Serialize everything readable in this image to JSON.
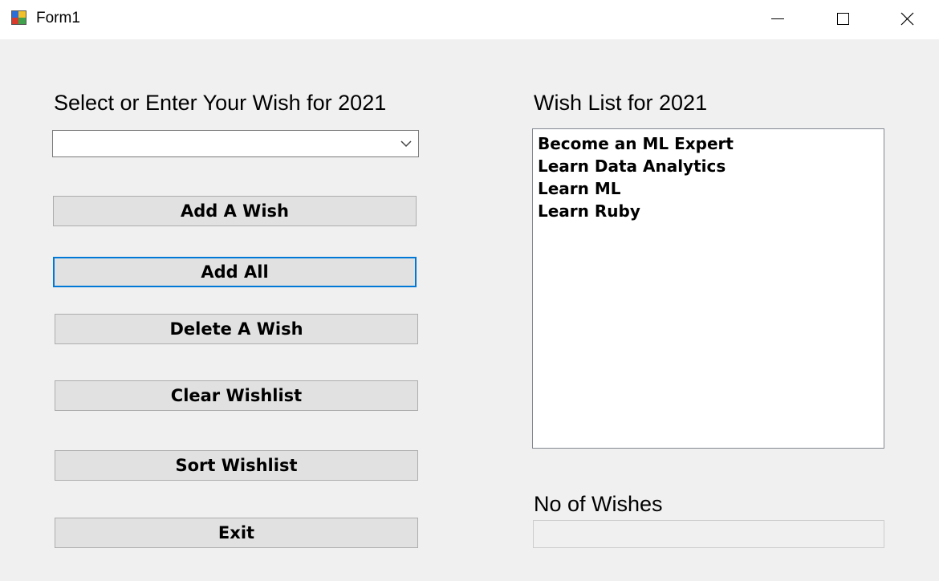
{
  "window": {
    "title": "Form1",
    "controls": [
      "minimize-icon",
      "maximize-icon",
      "close-icon"
    ]
  },
  "left_panel": {
    "heading": "Select or Enter Your Wish for 2021",
    "combo": {
      "value": "",
      "icon": "chevron-down-icon"
    },
    "buttons": {
      "add_wish": "Add A Wish",
      "add_all": "Add All",
      "delete_wish": "Delete A Wish",
      "clear_wishlist": "Clear Wishlist",
      "sort_wishlist": "Sort Wishlist",
      "exit": "Exit"
    }
  },
  "right_panel": {
    "heading": "Wish List for 2021",
    "wishes": [
      "Become an ML Expert",
      "Learn Data Analytics",
      "Learn ML",
      "Learn Ruby"
    ],
    "count_label": "No of Wishes",
    "count_value": ""
  },
  "colors": {
    "focus_border": "#0078d7",
    "button_face": "#e1e1e1",
    "form_background": "#f0f0f0"
  }
}
